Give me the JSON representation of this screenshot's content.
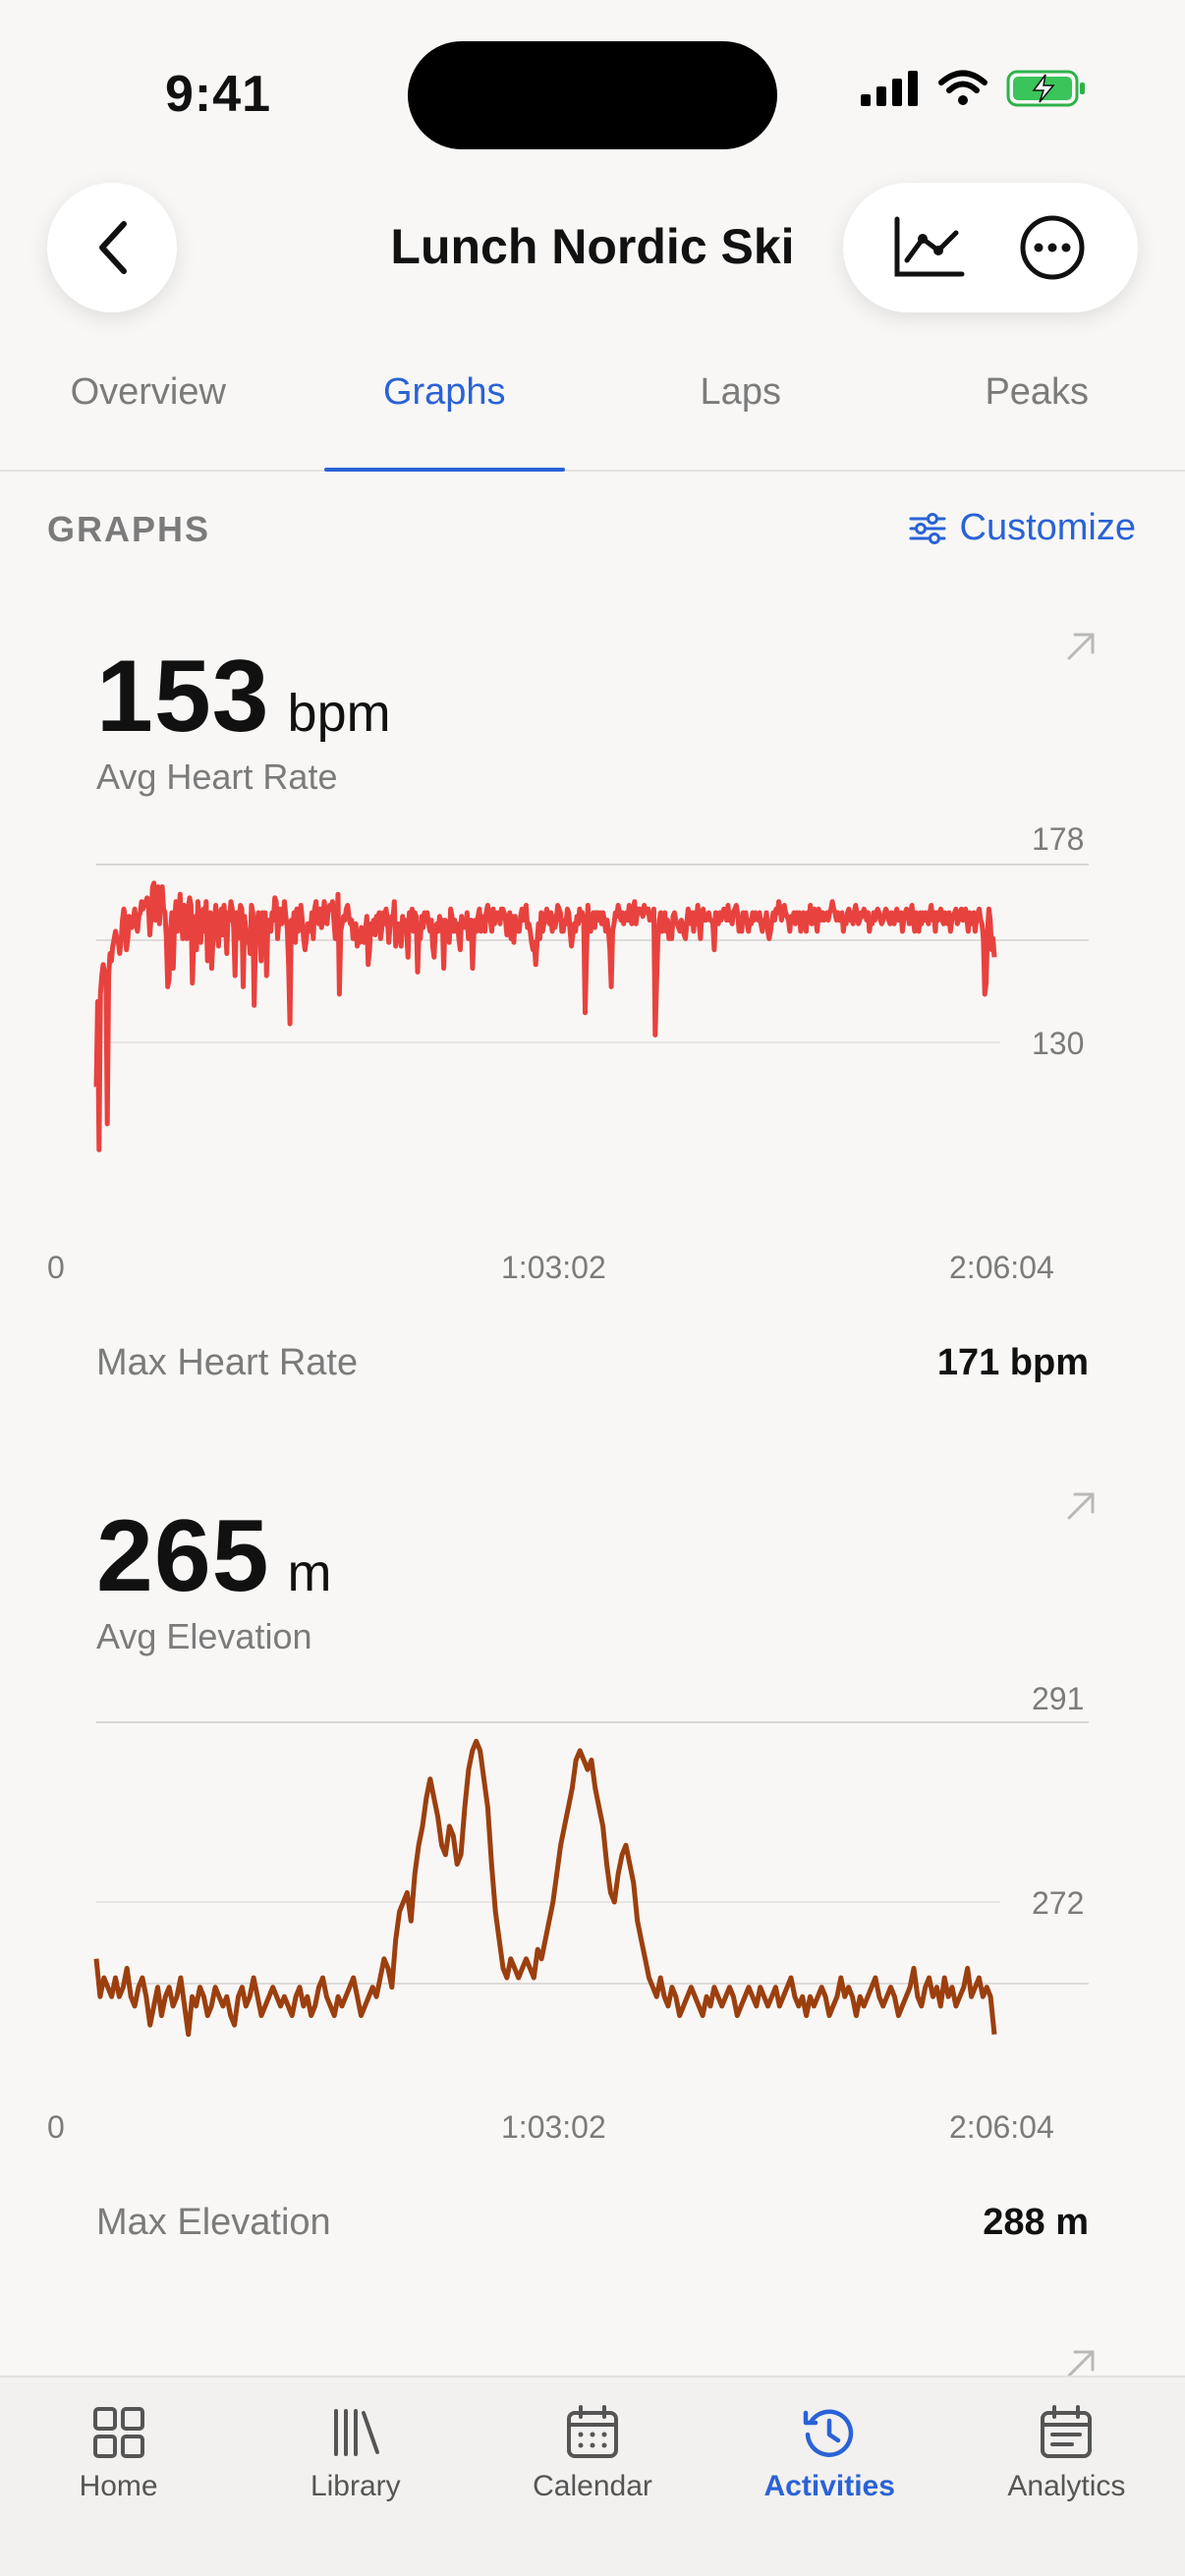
{
  "status": {
    "time": "9:41"
  },
  "header": {
    "title": "Lunch Nordic Ski"
  },
  "tabs": [
    {
      "label": "Overview",
      "active": false
    },
    {
      "label": "Graphs",
      "active": true
    },
    {
      "label": "Laps",
      "active": false
    },
    {
      "label": "Peaks",
      "active": false
    }
  ],
  "section": {
    "label": "GRAPHS",
    "customize_label": "Customize"
  },
  "cards": [
    {
      "value": "153",
      "unit": "bpm",
      "avg_label": "Avg Heart Rate",
      "y_top_label": "178",
      "y_mid_label": "130",
      "x_labels": [
        "0",
        "1:03:02",
        "2:06:04"
      ],
      "stat_label": "Max Heart Rate",
      "stat_value": "171 bpm",
      "color": "#e8423e"
    },
    {
      "value": "265",
      "unit": "m",
      "avg_label": "Avg Elevation",
      "y_top_label": "291",
      "y_mid_label": "272",
      "x_labels": [
        "0",
        "1:03:02",
        "2:06:04"
      ],
      "stat_label": "Max Elevation",
      "stat_value": "288 m",
      "color": "#9c3f0f"
    }
  ],
  "chart_data": [
    {
      "type": "line",
      "title": "",
      "series": [
        {
          "values": [
            118,
            141,
            101,
            143,
            148,
            151,
            149,
            148,
            108,
            148,
            154,
            152,
            156,
            158,
            160,
            158,
            157,
            154,
            157,
            163,
            166,
            164,
            155,
            158,
            164,
            162,
            161,
            163,
            166,
            162,
            160,
            164,
            165,
            168,
            166,
            167,
            168,
            169,
            167,
            159,
            164,
            172,
            173,
            163,
            171,
            172,
            162,
            170,
            172,
            166,
            165,
            158,
            145,
            147,
            160,
            165,
            150,
            163,
            168,
            160,
            163,
            170,
            163,
            158,
            167,
            164,
            158,
            166,
            169,
            167,
            146,
            158,
            164,
            155,
            168,
            164,
            157,
            163,
            166,
            160,
            168,
            152,
            164,
            165,
            150,
            158,
            163,
            167,
            160,
            156,
            164,
            166,
            159,
            167,
            162,
            154,
            165,
            163,
            168,
            166,
            161,
            148,
            165,
            158,
            163,
            167,
            166,
            145,
            164,
            160,
            157,
            159,
            154,
            167,
            165,
            140,
            160,
            162,
            165,
            159,
            152,
            165,
            155,
            165,
            148,
            163,
            162,
            160,
            165,
            163,
            169,
            168,
            158,
            163,
            166,
            162,
            163,
            168,
            164,
            161,
            151,
            135,
            163,
            160,
            165,
            157,
            166,
            160,
            163,
            167,
            163,
            158,
            155,
            158,
            162,
            160,
            160,
            165,
            158,
            166,
            168,
            163,
            162,
            166,
            161,
            163,
            168,
            165,
            162,
            166,
            167,
            166,
            168,
            163,
            158,
            160,
            170,
            143,
            160,
            162,
            164,
            163,
            166,
            167,
            164,
            162,
            163,
            158,
            161,
            162,
            156,
            159,
            157,
            161,
            158,
            157,
            160,
            164,
            151,
            155,
            162,
            160,
            163,
            159,
            164,
            163,
            165,
            158,
            161,
            165,
            162,
            166,
            163,
            157,
            162,
            164,
            163,
            168,
            156,
            160,
            162,
            161,
            156,
            164,
            162,
            163,
            160,
            153,
            165,
            163,
            166,
            160,
            165,
            164,
            149,
            160,
            158,
            164,
            161,
            165,
            163,
            165,
            162,
            160,
            163,
            156,
            153,
            161,
            162,
            160,
            164,
            162,
            163,
            150,
            163,
            160,
            161,
            157,
            166,
            164,
            160,
            163,
            160,
            162,
            158,
            155,
            164,
            161,
            162,
            161,
            165,
            158,
            160,
            163,
            150,
            160,
            163,
            160,
            164,
            166,
            160,
            164,
            162,
            160,
            165,
            167,
            165,
            163,
            160,
            166,
            162,
            165,
            164,
            165,
            162,
            166,
            166,
            165,
            163,
            159,
            162,
            165,
            158,
            164,
            157,
            164,
            160,
            162,
            160,
            164,
            166,
            163,
            165,
            167,
            161,
            162,
            160,
            157,
            155,
            157,
            151,
            157,
            162,
            158,
            165,
            160,
            162,
            164,
            166,
            163,
            162,
            165,
            160,
            164,
            161,
            163,
            167,
            166,
            165,
            160,
            160,
            163,
            162,
            166,
            165,
            160,
            156,
            159,
            162,
            160,
            164,
            162,
            166,
            163,
            165,
            162,
            138,
            154,
            167,
            162,
            160,
            163,
            165,
            161,
            165,
            165,
            163,
            165,
            162,
            165,
            163,
            160,
            163,
            160,
            155,
            145,
            160,
            162,
            165,
            164,
            167,
            165,
            163,
            165,
            162,
            164,
            165,
            163,
            167,
            163,
            162,
            166,
            168,
            162,
            165,
            166,
            166,
            165,
            164,
            167,
            165,
            166,
            166,
            163,
            164,
            163,
            166,
            132,
            146,
            158,
            163,
            165,
            160,
            163,
            165,
            160,
            163,
            158,
            162,
            158,
            164,
            165,
            163,
            162,
            161,
            160,
            163,
            162,
            159,
            158,
            162,
            166,
            163,
            162,
            165,
            160,
            165,
            162,
            167,
            162,
            158,
            165,
            166,
            163,
            163,
            164,
            165,
            163,
            163,
            162,
            155,
            165,
            163,
            162,
            165,
            163,
            165,
            166,
            165,
            163,
            167,
            163,
            165,
            162,
            165,
            166,
            167,
            165,
            160,
            162,
            160,
            165,
            163,
            165,
            162,
            160,
            163,
            162,
            165,
            163,
            165,
            164,
            163,
            165,
            162,
            160,
            163,
            162,
            165,
            160,
            158,
            160,
            163,
            165,
            163,
            166,
            165,
            168,
            166,
            163,
            165,
            167,
            165,
            164,
            163,
            160,
            164,
            163,
            165,
            162,
            165,
            163,
            165,
            160,
            163,
            165,
            162,
            160,
            165,
            163,
            167,
            162,
            165,
            166,
            163,
            160,
            166,
            165,
            163,
            165,
            163,
            164,
            165,
            163,
            165,
            166,
            168,
            166,
            165,
            163,
            165,
            163,
            163,
            165,
            160,
            163,
            162,
            165,
            166,
            163,
            165,
            162,
            165,
            167,
            165,
            162,
            163,
            165,
            164,
            166,
            165,
            163,
            165,
            160,
            163,
            162,
            165,
            163,
            165,
            166,
            165,
            163,
            162,
            163,
            165,
            166,
            165,
            163,
            162,
            165,
            163,
            162,
            165,
            166,
            163,
            163,
            165,
            160,
            163,
            165,
            166,
            165,
            162,
            165,
            167,
            163,
            160,
            165,
            163,
            160,
            165,
            162,
            165,
            163,
            165,
            163,
            162,
            165,
            167,
            163,
            165,
            160,
            165,
            163,
            165,
            166,
            163,
            162,
            165,
            163,
            162,
            165,
            160,
            163,
            164,
            165,
            166,
            162,
            163,
            165,
            166,
            163,
            165,
            166,
            163,
            160,
            165,
            163,
            162,
            165,
            160,
            163,
            165,
            166,
            163,
            162,
            158,
            143,
            146,
            160,
            166,
            163,
            155,
            158,
            153
          ]
        }
      ]
    },
    {
      "type": "line",
      "title": "",
      "series": [
        {
          "values": [
            266,
            262,
            264,
            263,
            262,
            264,
            262,
            263,
            265,
            262,
            261,
            263,
            264,
            262,
            259,
            261,
            263,
            260,
            262,
            263,
            261,
            262,
            264,
            261,
            258,
            262,
            261,
            263,
            262,
            260,
            261,
            263,
            262,
            261,
            262,
            260,
            259,
            262,
            263,
            261,
            262,
            264,
            262,
            260,
            261,
            262,
            263,
            262,
            261,
            262,
            261,
            260,
            262,
            263,
            261,
            262,
            260,
            261,
            263,
            264,
            262,
            261,
            260,
            262,
            261,
            262,
            263,
            264,
            262,
            260,
            261,
            262,
            263,
            262,
            264,
            266,
            265,
            263,
            268,
            271,
            272,
            273,
            270,
            275,
            278,
            280,
            283,
            285,
            283,
            281,
            278,
            277,
            280,
            279,
            276,
            277,
            282,
            286,
            288,
            289,
            288,
            285,
            282,
            276,
            271,
            268,
            265,
            264,
            266,
            265,
            264,
            265,
            266,
            265,
            264,
            267,
            266,
            268,
            270,
            272,
            275,
            278,
            280,
            282,
            284,
            287,
            288,
            287,
            286,
            287,
            284,
            282,
            280,
            276,
            273,
            272,
            275,
            277,
            278,
            276,
            274,
            270,
            268,
            266,
            264,
            263,
            262,
            264,
            262,
            261,
            263,
            262,
            260,
            261,
            262,
            263,
            262,
            261,
            260,
            262,
            261,
            263,
            262,
            261,
            262,
            263,
            262,
            260,
            261,
            262,
            263,
            262,
            261,
            263,
            262,
            261,
            262,
            263,
            261,
            262,
            263,
            264,
            262,
            261,
            262,
            260,
            262,
            261,
            262,
            263,
            262,
            260,
            261,
            262,
            264,
            262,
            263,
            262,
            260,
            262,
            261,
            262,
            263,
            264,
            262,
            261,
            262,
            263,
            262,
            260,
            261,
            262,
            263,
            265,
            262,
            261,
            263,
            264,
            262,
            263,
            261,
            264,
            262,
            263,
            261,
            262,
            263,
            265,
            262,
            263,
            264,
            262,
            263,
            262,
            258
          ]
        }
      ]
    }
  ],
  "tabbar": [
    {
      "label": "Home",
      "icon": "home-icon",
      "active": false
    },
    {
      "label": "Library",
      "icon": "library-icon",
      "active": false
    },
    {
      "label": "Calendar",
      "icon": "calendar-icon",
      "active": false
    },
    {
      "label": "Activities",
      "icon": "activities-icon",
      "active": true
    },
    {
      "label": "Analytics",
      "icon": "analytics-icon",
      "active": false
    }
  ]
}
